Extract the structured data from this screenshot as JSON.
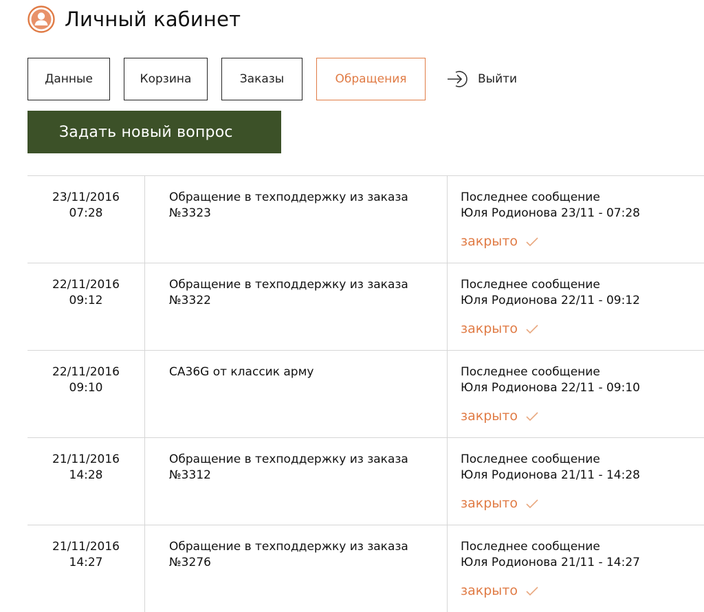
{
  "header": {
    "title": "Личный кабинет",
    "accent_color": "#e07b45"
  },
  "tabs": [
    {
      "label": "Данные",
      "active": false
    },
    {
      "label": "Корзина",
      "active": false
    },
    {
      "label": "Заказы",
      "active": false
    },
    {
      "label": "Обращения",
      "active": true
    }
  ],
  "logout": {
    "label": "Выйти",
    "icon": "logout-arrow-icon"
  },
  "ask_button": {
    "label": "Задать новый вопрос",
    "color": "#3c5128"
  },
  "tickets": [
    {
      "date": "23/11/2016",
      "time": "07:28",
      "subject_line1": "Обращение в техподдержку из заказа",
      "subject_line2": "№3323",
      "last_label": "Последнее сообщение",
      "last_info": "Юля Родионова 23/11 - 07:28",
      "status": "закрыто"
    },
    {
      "date": "22/11/2016",
      "time": "09:12",
      "subject_line1": "Обращение в техподдержку из заказа",
      "subject_line2": "№3322",
      "last_label": "Последнее сообщение",
      "last_info": "Юля Родионова 22/11 - 09:12",
      "status": "закрыто"
    },
    {
      "date": "22/11/2016",
      "time": "09:10",
      "subject_line1": "CA36G от классик арму",
      "subject_line2": "",
      "last_label": "Последнее сообщение",
      "last_info": "Юля Родионова 22/11 - 09:10",
      "status": "закрыто"
    },
    {
      "date": "21/11/2016",
      "time": "14:28",
      "subject_line1": "Обращение в техподдержку из заказа",
      "subject_line2": "№3312",
      "last_label": "Последнее сообщение",
      "last_info": "Юля Родионова 21/11 - 14:28",
      "status": "закрыто"
    },
    {
      "date": "21/11/2016",
      "time": "14:27",
      "subject_line1": "Обращение в техподдержку из заказа",
      "subject_line2": "№3276",
      "last_label": "Последнее сообщение",
      "last_info": "Юля Родионова 21/11 - 14:27",
      "status": "закрыто"
    }
  ]
}
